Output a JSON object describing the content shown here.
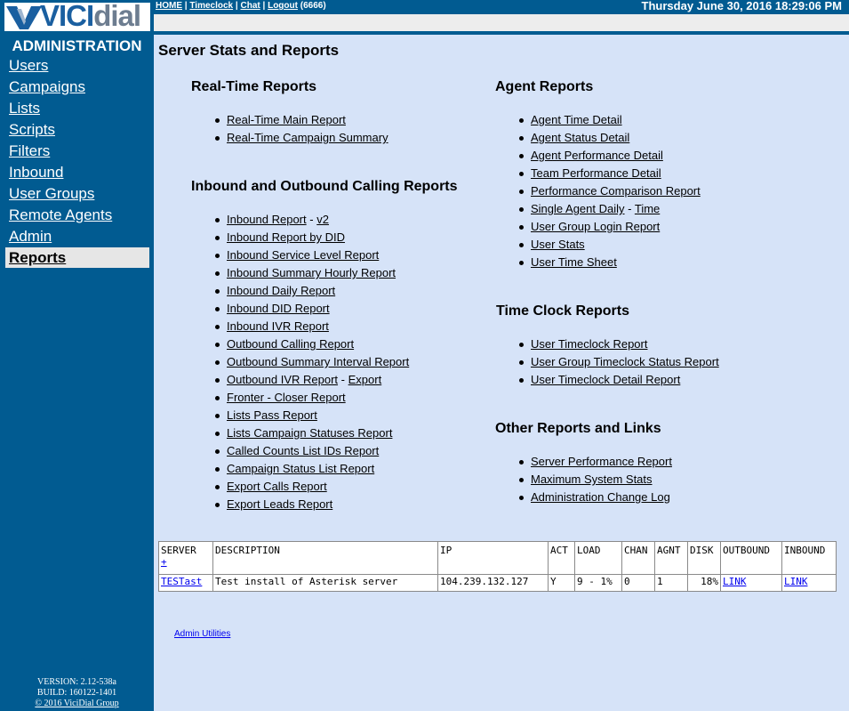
{
  "logo": {
    "part1": "VICI",
    "part2": "dial"
  },
  "sidebar": {
    "heading": "ADMINISTRATION",
    "items": [
      {
        "label": "Users"
      },
      {
        "label": "Campaigns"
      },
      {
        "label": "Lists"
      },
      {
        "label": "Scripts"
      },
      {
        "label": "Filters"
      },
      {
        "label": "Inbound"
      },
      {
        "label": "User Groups"
      },
      {
        "label": "Remote Agents"
      },
      {
        "label": "Admin"
      },
      {
        "label": "Reports"
      }
    ],
    "version": "VERSION: 2.12-538a",
    "build": "BUILD: 160122-1401",
    "copyright": "© 2016 ViciDial Group"
  },
  "topbar": {
    "home": "HOME",
    "timeclock": "Timeclock",
    "chat": "Chat",
    "logout": "Logout",
    "user": "(6666)",
    "sep": "|",
    "datetime": "Thursday June 30, 2016 18:29:06 PM"
  },
  "page_title": "Server Stats and Reports",
  "realtime": {
    "title": "Real-Time Reports",
    "items": [
      "Real-Time Main Report",
      "Real-Time Campaign Summary"
    ]
  },
  "calling": {
    "title": "Inbound and Outbound Calling Reports",
    "items": [
      {
        "label": "Inbound Report",
        "extra": "v2"
      },
      {
        "label": "Inbound Report by DID"
      },
      {
        "label": "Inbound Service Level Report"
      },
      {
        "label": "Inbound Summary Hourly Report"
      },
      {
        "label": "Inbound Daily Report"
      },
      {
        "label": "Inbound DID Report"
      },
      {
        "label": "Inbound IVR Report"
      },
      {
        "label": "Outbound Calling Report"
      },
      {
        "label": "Outbound Summary Interval Report"
      },
      {
        "label": "Outbound IVR Report",
        "extra": "Export"
      },
      {
        "label": "Fronter - Closer Report"
      },
      {
        "label": "Lists Pass Report"
      },
      {
        "label": "Lists Campaign Statuses Report"
      },
      {
        "label": "Called Counts List IDs Report"
      },
      {
        "label": "Campaign Status List Report"
      },
      {
        "label": "Export Calls Report"
      },
      {
        "label": "Export Leads Report"
      }
    ],
    "dash": "-"
  },
  "agent": {
    "title": "Agent Reports",
    "items": [
      {
        "label": "Agent Time Detail"
      },
      {
        "label": "Agent Status Detail"
      },
      {
        "label": "Agent Performance Detail"
      },
      {
        "label": "Team Performance Detail"
      },
      {
        "label": "Performance Comparison Report"
      },
      {
        "label": "Single Agent Daily",
        "extra": "Time"
      },
      {
        "label": "User Group Login Report"
      },
      {
        "label": "User Stats"
      },
      {
        "label": "User Time Sheet"
      }
    ]
  },
  "timeclock": {
    "title": "Time Clock Reports",
    "items": [
      "User Timeclock Report",
      "User Group Timeclock Status Report",
      "User Timeclock Detail Report"
    ]
  },
  "other": {
    "title": "Other Reports and Links",
    "items": [
      "Server Performance Report",
      "Maximum System Stats",
      "Administration Change Log"
    ]
  },
  "server_table": {
    "headers": {
      "server": "SERVER",
      "plus": "+",
      "description": "DESCRIPTION",
      "ip": "IP",
      "act": "ACT",
      "load": "LOAD",
      "chan": "CHAN",
      "agnt": "AGNT",
      "disk": "DISK",
      "outbound": "OUTBOUND",
      "inbound": "INBOUND"
    },
    "row": {
      "server": "TESTast",
      "description": "Test install of Asterisk server",
      "ip": "104.239.132.127",
      "act": "Y",
      "load": "9 - 1%",
      "chan": "0",
      "agnt": "1",
      "disk": "18%",
      "outbound": "LINK",
      "inbound": "LINK"
    }
  },
  "admin_utilities": "Admin Utilities"
}
